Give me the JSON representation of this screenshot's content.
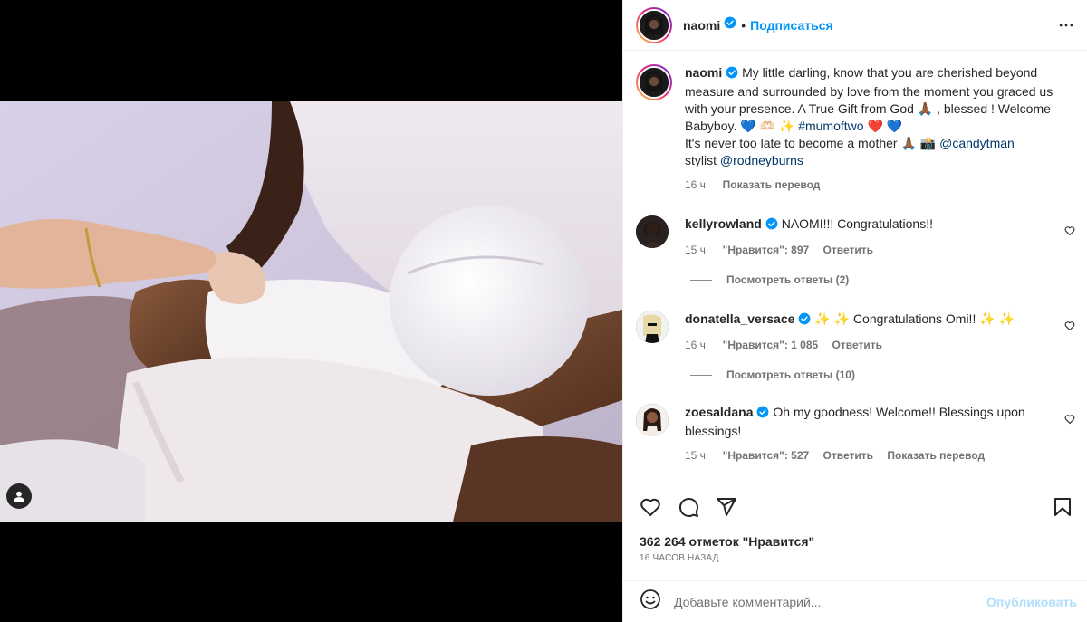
{
  "header": {
    "username": "naomi",
    "dot": "•",
    "follow_label": "Подписаться",
    "more_icon": "more-horizontal-icon"
  },
  "caption": {
    "username": "naomi",
    "line1": "My little darling, know that you are cherished beyond measure and surrounded by love from the moment you graced us with your presence. A True Gift from God 🙏🏾 , blessed ! Welcome Babyboy. 💙 🫶🏻 ✨",
    "hashtag": "#mumoftwo",
    "hearts": "❤️ 💙",
    "line2": "It's never too late to become a mother 🙏🏾 📸",
    "mention1": "@candytman",
    "stylist_label": "stylist",
    "mention2": "@rodneyburns",
    "time": "16 ч.",
    "translate": "Показать перевод"
  },
  "comments": [
    {
      "username": "kellyrowland",
      "text": "NAOMI!!! Congratulations!!",
      "time": "15 ч.",
      "likes": "\"Нравится\": 897",
      "reply": "Ответить",
      "replies": "Посмотреть ответы (2)"
    },
    {
      "username": "donatella_versace",
      "text": "✨ ✨ Congratulations Omi!! ✨ ✨",
      "time": "16 ч.",
      "likes": "\"Нравится\": 1 085",
      "reply": "Ответить",
      "replies": "Посмотреть ответы (10)"
    },
    {
      "username": "zoesaldana",
      "text": "Oh my goodness! Welcome!! Blessings upon blessings!",
      "time": "15 ч.",
      "likes": "\"Нравится\": 527",
      "reply": "Ответить",
      "translate": "Показать перевод"
    }
  ],
  "actions": {
    "like_icon": "heart-icon",
    "comment_icon": "comment-icon",
    "share_icon": "send-icon",
    "save_icon": "bookmark-icon"
  },
  "likes_text": "362 264 отметок \"Нравится\"",
  "time_ago": "16 ЧАСОВ НАЗАД",
  "add_comment": {
    "placeholder": "Добавьте комментарий...",
    "publish": "Опубликовать",
    "emoji_icon": "emoji-icon"
  },
  "colors": {
    "accent": "#0095f6",
    "link": "#00376b",
    "muted": "#737373",
    "publish_disabled": "#b2dffc",
    "verified": "#0095f6"
  }
}
